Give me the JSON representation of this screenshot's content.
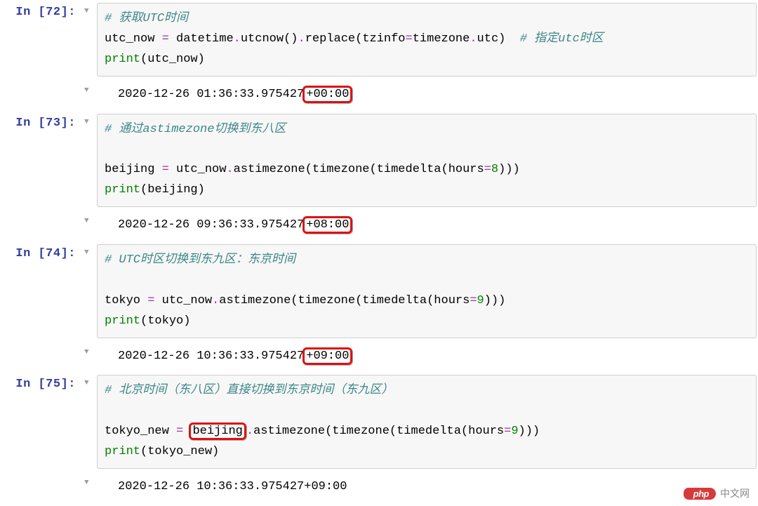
{
  "cells": [
    {
      "prompt": "In [72]:",
      "code_tokens": [
        [
          {
            "t": "# 获取UTC时间",
            "cls": "c-comment"
          }
        ],
        [
          {
            "t": "utc_now ",
            "cls": "c-ident"
          },
          {
            "t": "=",
            "cls": "c-op"
          },
          {
            "t": " datetime",
            "cls": "c-ident"
          },
          {
            "t": ".",
            "cls": "c-op"
          },
          {
            "t": "utcnow()",
            "cls": "c-ident"
          },
          {
            "t": ".",
            "cls": "c-op"
          },
          {
            "t": "replace(tzinfo",
            "cls": "c-ident"
          },
          {
            "t": "=",
            "cls": "c-op"
          },
          {
            "t": "timezone",
            "cls": "c-ident"
          },
          {
            "t": ".",
            "cls": "c-op"
          },
          {
            "t": "utc)  ",
            "cls": "c-ident"
          },
          {
            "t": "# 指定utc时区",
            "cls": "c-comment"
          }
        ],
        [
          {
            "t": "print",
            "cls": "c-func"
          },
          {
            "t": "(utc_now)",
            "cls": "c-ident"
          }
        ]
      ],
      "output_prefix": "2020-12-26 01:36:33.975427",
      "output_highlight": "+00:00",
      "output_suffix": ""
    },
    {
      "prompt": "In [73]:",
      "code_tokens": [
        [
          {
            "t": "# 通过astimezone切换到东八区",
            "cls": "c-comment"
          }
        ],
        [
          {
            "t": "",
            "cls": "c-ident"
          }
        ],
        [
          {
            "t": "beijing ",
            "cls": "c-ident"
          },
          {
            "t": "=",
            "cls": "c-op"
          },
          {
            "t": " utc_now",
            "cls": "c-ident"
          },
          {
            "t": ".",
            "cls": "c-op"
          },
          {
            "t": "astimezone(timezone(timedelta(hours",
            "cls": "c-ident"
          },
          {
            "t": "=",
            "cls": "c-op"
          },
          {
            "t": "8",
            "cls": "c-num"
          },
          {
            "t": ")))",
            "cls": "c-ident"
          }
        ],
        [
          {
            "t": "print",
            "cls": "c-func"
          },
          {
            "t": "(beijing)",
            "cls": "c-ident"
          }
        ]
      ],
      "output_prefix": "2020-12-26 09:36:33.975427",
      "output_highlight": "+08:00",
      "output_suffix": ""
    },
    {
      "prompt": "In [74]:",
      "code_tokens": [
        [
          {
            "t": "# UTC时区切换到东九区：东京时间",
            "cls": "c-comment"
          }
        ],
        [
          {
            "t": "",
            "cls": "c-ident"
          }
        ],
        [
          {
            "t": "tokyo ",
            "cls": "c-ident"
          },
          {
            "t": "=",
            "cls": "c-op"
          },
          {
            "t": " utc_now",
            "cls": "c-ident"
          },
          {
            "t": ".",
            "cls": "c-op"
          },
          {
            "t": "astimezone(timezone(timedelta(hours",
            "cls": "c-ident"
          },
          {
            "t": "=",
            "cls": "c-op"
          },
          {
            "t": "9",
            "cls": "c-num"
          },
          {
            "t": ")))",
            "cls": "c-ident"
          }
        ],
        [
          {
            "t": "print",
            "cls": "c-func"
          },
          {
            "t": "(tokyo)",
            "cls": "c-ident"
          }
        ]
      ],
      "output_prefix": "2020-12-26 10:36:33.975427",
      "output_highlight": "+09:00",
      "output_suffix": ""
    },
    {
      "prompt": "In [75]:",
      "code_tokens": [
        [
          {
            "t": "# 北京时间（东八区）直接切换到东京时间（东九区）",
            "cls": "c-comment"
          }
        ],
        [
          {
            "t": "",
            "cls": "c-ident"
          }
        ],
        [
          {
            "t": "tokyo_new ",
            "cls": "c-ident"
          },
          {
            "t": "=",
            "cls": "c-op"
          },
          {
            "t": " ",
            "cls": "c-ident"
          },
          {
            "t": "beijing",
            "cls": "c-ident",
            "hl": true
          },
          {
            "t": ".",
            "cls": "c-op"
          },
          {
            "t": "astimezone(timezone(timedelta(hours",
            "cls": "c-ident"
          },
          {
            "t": "=",
            "cls": "c-op"
          },
          {
            "t": "9",
            "cls": "c-num"
          },
          {
            "t": ")))",
            "cls": "c-ident"
          }
        ],
        [
          {
            "t": "print",
            "cls": "c-func"
          },
          {
            "t": "(tokyo_new)",
            "cls": "c-ident"
          }
        ]
      ],
      "output_prefix": "2020-12-26 10:36:33.975427+09:00",
      "output_highlight": "",
      "output_suffix": ""
    }
  ],
  "watermark": {
    "badge": "php",
    "text": "中文网"
  },
  "icons": {
    "collapser": "▼"
  }
}
